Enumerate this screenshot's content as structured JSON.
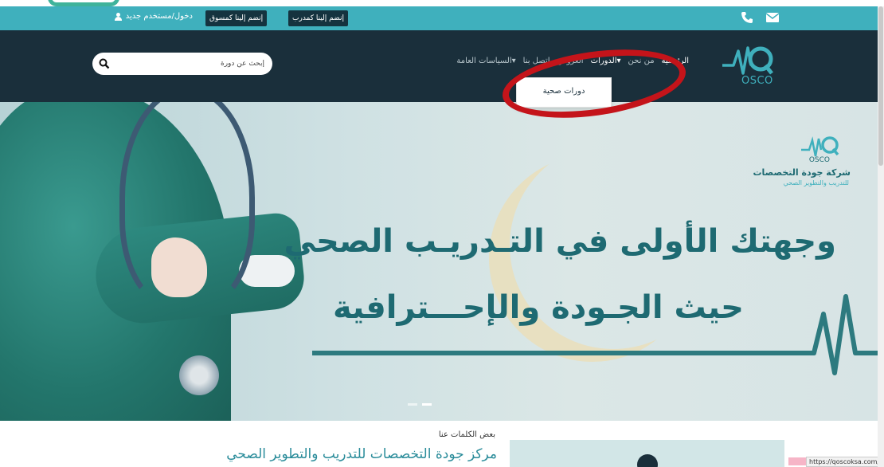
{
  "utility_bar": {
    "login_label": "دخول/مستخدم جديد",
    "join_marketer_label": "إنضم إلينا كمسوق",
    "join_trainer_label": "إنضم إلينا كمدرب",
    "icons": [
      "user-icon",
      "phone-icon",
      "envelope-icon"
    ]
  },
  "header": {
    "brand_text": "OSCO",
    "nav": {
      "home": "الرئيسية",
      "about": "من نحن",
      "courses": "الدورات",
      "offers": "العروض",
      "contact": "اتصل بنا",
      "policies": "السياسات العامة"
    },
    "search": {
      "placeholder": "إبحث عن دورة"
    },
    "dropdown": {
      "items": [
        "دورات صحية"
      ]
    }
  },
  "hero": {
    "brand_name": "شركة جودة التخصصات",
    "brand_sub": "للتدريب والتطوير الصحي",
    "brand_osco": "OSCO",
    "headline_line1": "وجهتك الأولى في التـدريـب الصحي",
    "headline_line2": "حيث الجـودة والإحـــترافية"
  },
  "about": {
    "eyebrow": "بعض الكلمات عنا",
    "title": "مركز جودة التخصصات للتدريب والتطوير الصحي"
  },
  "status_url": "https://qoscoksa.com/"
}
